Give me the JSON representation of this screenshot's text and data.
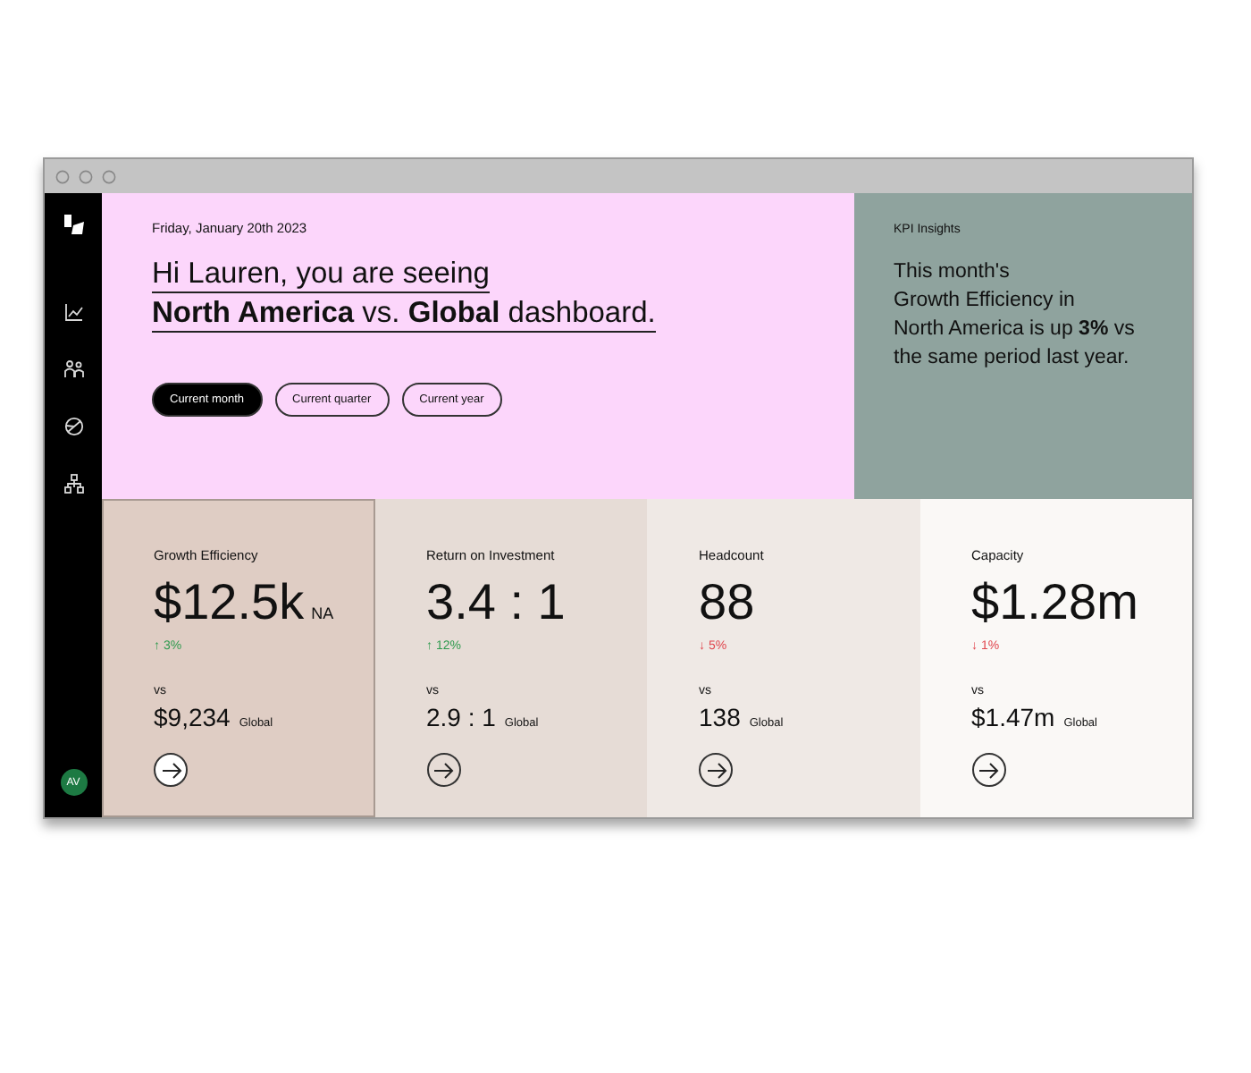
{
  "sidebar": {
    "items": [
      {
        "kind": "chart",
        "selected": false
      },
      {
        "kind": "people",
        "selected": false
      },
      {
        "kind": "pie",
        "selected": false
      },
      {
        "kind": "org",
        "selected": false
      }
    ],
    "avatar": "AV"
  },
  "hero": {
    "date": "Friday, January 20th 2023",
    "headline": [
      "Hi Lauren, you are seeing",
      "**North America** vs. **Global** dashboard."
    ],
    "periods": [
      {
        "label": "Current month",
        "selected": true
      },
      {
        "label": "Current quarter",
        "selected": false
      },
      {
        "label": "Current year",
        "selected": false
      }
    ]
  },
  "insight": {
    "title": "KPI Insights",
    "text": [
      "This month's",
      "Growth Efficiency in",
      "North America is up **3%** vs",
      "the same period last year."
    ]
  },
  "kpis": [
    {
      "title": "Growth Efficiency",
      "value": "$12.5k",
      "unit": "NA",
      "kind": "up",
      "change": "↑ 3%",
      "vs": "vs",
      "global_value": "$9,234",
      "global_label": "Global",
      "color": "#dfcdc4",
      "selected": true
    },
    {
      "title": "Return on Investment",
      "value": "3.4 : 1",
      "kind": "up",
      "change": "↑ 12%",
      "vs": "vs",
      "global_value": "2.9 : 1",
      "global_label": "Global",
      "color": "#e6dcd6",
      "selected": false
    },
    {
      "title": "Headcount",
      "value": "88",
      "kind": "down",
      "change": "↓ 5%",
      "vs": "vs",
      "global_value": "138",
      "global_label": "Global",
      "color": "#efe9e5",
      "selected": false
    },
    {
      "title": "Capacity",
      "value": "$1.28m",
      "kind": "down",
      "change": "↓ 1%",
      "vs": "vs",
      "global_value": "$1.47m",
      "global_label": "Global",
      "color": "#faf8f6",
      "selected": false
    }
  ]
}
